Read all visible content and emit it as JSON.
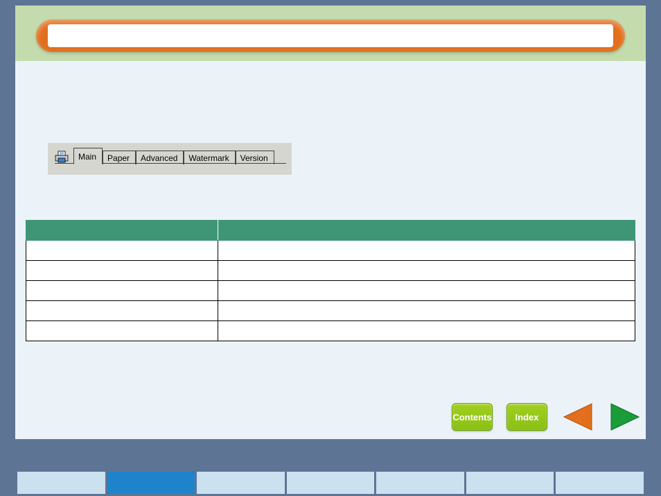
{
  "header": {
    "title": ""
  },
  "tabs": {
    "items": [
      {
        "label": "Main",
        "active": true
      },
      {
        "label": "Paper",
        "active": false
      },
      {
        "label": "Advanced",
        "active": false
      },
      {
        "label": "Watermark",
        "active": false
      },
      {
        "label": "Version",
        "active": false
      }
    ]
  },
  "table": {
    "headers": [
      "",
      ""
    ],
    "rows": [
      [
        "",
        ""
      ],
      [
        "",
        ""
      ],
      [
        "",
        ""
      ],
      [
        "",
        ""
      ],
      [
        "",
        ""
      ]
    ]
  },
  "nav": {
    "contents_label": "Contents",
    "index_label": "Index"
  },
  "footer_tabs": [
    {
      "active": false
    },
    {
      "active": true
    },
    {
      "active": false
    },
    {
      "active": false
    },
    {
      "active": false
    },
    {
      "active": false
    },
    {
      "active": false
    }
  ]
}
